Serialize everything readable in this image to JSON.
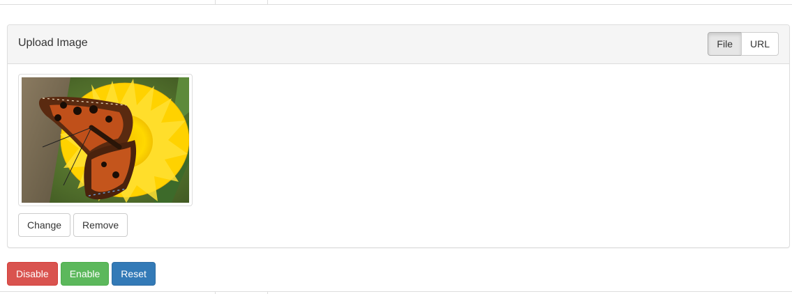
{
  "panel": {
    "title": "Upload Image",
    "source_toggle": [
      {
        "label": "File",
        "active": true
      },
      {
        "label": "URL",
        "active": false
      }
    ]
  },
  "preview": {
    "image_subject": "butterfly-on-yellow-flower"
  },
  "file_actions": {
    "change_label": "Change",
    "remove_label": "Remove"
  },
  "actions": {
    "disable_label": "Disable",
    "enable_label": "Enable",
    "reset_label": "Reset"
  },
  "colors": {
    "danger": "#d9534f",
    "success": "#5cb85c",
    "primary": "#337ab7",
    "panel_heading_bg": "#f5f5f5",
    "border": "#dddddd"
  }
}
